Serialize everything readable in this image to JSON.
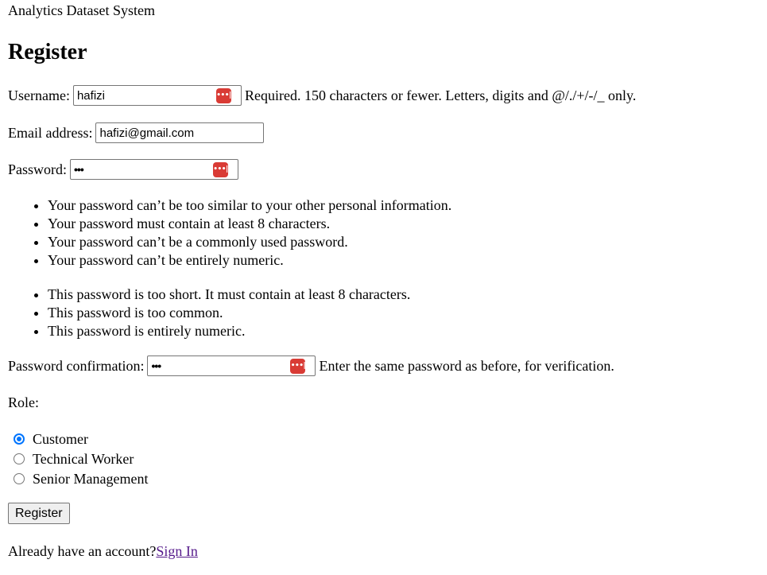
{
  "site": {
    "title": "Analytics Dataset System"
  },
  "page": {
    "heading": "Register"
  },
  "form": {
    "username": {
      "label": "Username:",
      "value": "hafizi",
      "help": "Required. 150 characters or fewer. Letters, digits and @/./+/-/_ only."
    },
    "email": {
      "label": "Email address:",
      "value": "hafizi@gmail.com"
    },
    "password": {
      "label": "Password:",
      "value": "•••",
      "requirements": [
        "Your password can’t be too similar to your other personal information.",
        "Your password must contain at least 8 characters.",
        "Your password can’t be a commonly used password.",
        "Your password can’t be entirely numeric."
      ],
      "errors": [
        "This password is too short. It must contain at least 8 characters.",
        "This password is too common.",
        "This password is entirely numeric."
      ]
    },
    "password_confirmation": {
      "label": "Password confirmation:",
      "value": "•••",
      "help": "Enter the same password as before, for verification."
    },
    "role": {
      "label": "Role:",
      "options": [
        {
          "label": "Customer",
          "checked": true
        },
        {
          "label": "Technical Worker",
          "checked": false
        },
        {
          "label": "Senior Management",
          "checked": false
        }
      ]
    },
    "submit_label": "Register"
  },
  "footer": {
    "prompt": "Already have an account?",
    "link": "Sign In"
  },
  "icons": {
    "password_manager": "password-manager-icon",
    "password_manager_color": "#d93b35",
    "radio_accent": "#0075ff",
    "link_color": "#551a8b"
  }
}
